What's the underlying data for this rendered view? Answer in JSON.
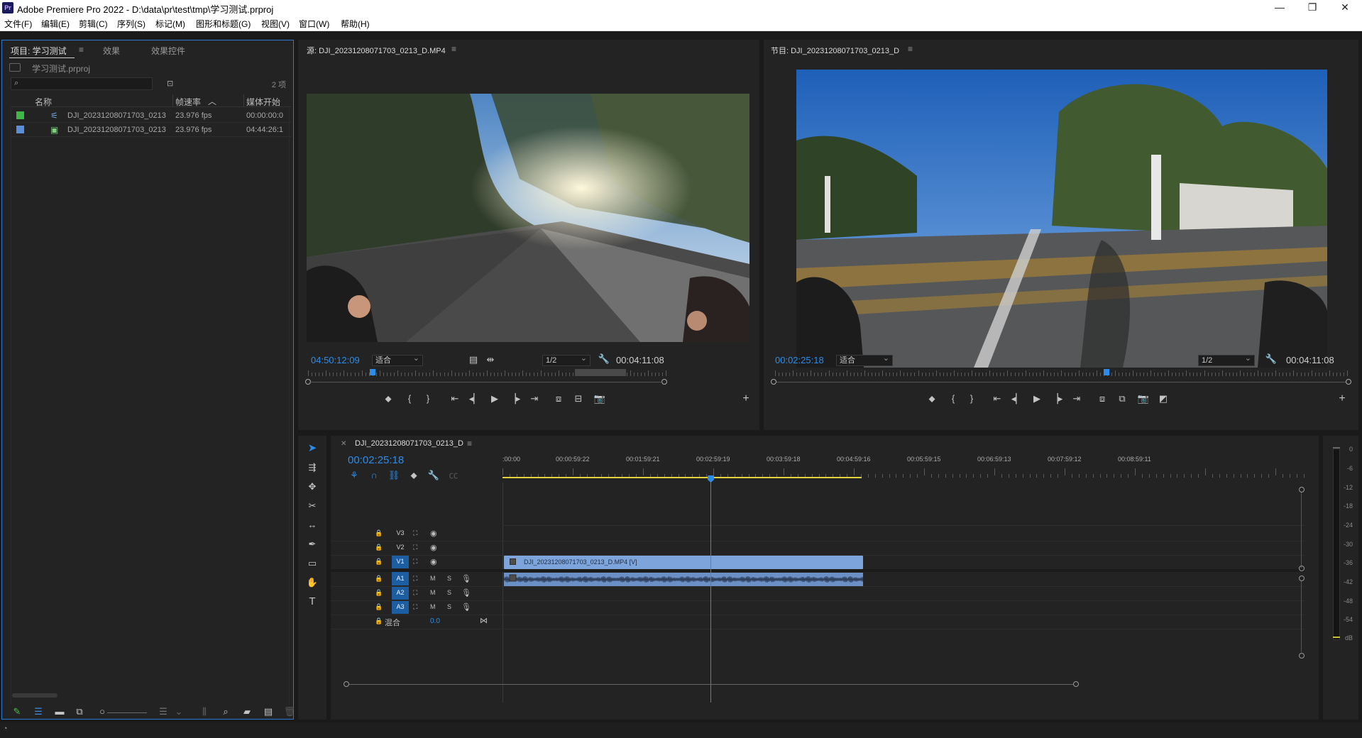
{
  "window": {
    "app_icon": "Pr",
    "title": "Adobe Premiere Pro 2022 - D:\\data\\pr\\test\\tmp\\学习测试.prproj",
    "minimize": "—",
    "maximize": "❐",
    "close": "✕"
  },
  "menu": [
    "文件(F)",
    "编辑(E)",
    "剪辑(C)",
    "序列(S)",
    "标记(M)",
    "图形和标题(G)",
    "视图(V)",
    "窗口(W)",
    "帮助(H)"
  ],
  "project": {
    "tabs": [
      "项目: 学习测试",
      "效果",
      "效果控件"
    ],
    "file_name": "学习测试.prproj",
    "search_placeholder": "",
    "item_count": "2 项",
    "columns": {
      "name": "名称",
      "fps": "帧速率",
      "start": "媒体开始"
    },
    "items": [
      {
        "label_color": "#3fb54a",
        "icon": "sequence-icon",
        "name": "DJI_20231208071703_0213",
        "fps": "23.976 fps",
        "start": "00:00:00:0"
      },
      {
        "label_color": "#5b8dd9",
        "icon": "video-clip-icon",
        "name": "DJI_20231208071703_0213",
        "fps": "23.976 fps",
        "start": "04:44:26:1"
      }
    ]
  },
  "source": {
    "title": "源: DJI_20231208071703_0213_D.MP4",
    "timecode": "04:50:12:09",
    "fit": "适合",
    "resolution": "1/2",
    "duration": "00:04:11:08",
    "playhead_fraction": 0.18
  },
  "program": {
    "title": "节目: DJI_20231208071703_0213_D",
    "timecode": "00:02:25:18",
    "fit": "适合",
    "resolution": "1/2",
    "duration": "00:04:11:08",
    "playhead_fraction": 0.58
  },
  "timeline": {
    "sequence_name": "DJI_20231208071703_0213_D",
    "timecode": "00:02:25:18",
    "ruler": [
      ":00:00",
      "00:00:59:22",
      "00:01:59:21",
      "00:02:59:19",
      "00:03:59:18",
      "00:04:59:16",
      "00:05:59:15",
      "00:06:59:13",
      "00:07:59:12",
      "00:08:59:11"
    ],
    "video_tracks": [
      "V3",
      "V2",
      "V1"
    ],
    "audio_tracks": [
      "A1",
      "A2",
      "A3"
    ],
    "mix_label": "混合",
    "mix_value": "0.0",
    "video_clip_label": "DJI_20231208071703_0213_D.MP4 [V]",
    "track_m": "M",
    "track_s": "S"
  },
  "meter": {
    "labels": [
      "0",
      "-6",
      "-12",
      "-18",
      "-24",
      "-30",
      "-36",
      "-42",
      "-48",
      "-54",
      "dB"
    ]
  },
  "colors": {
    "accent": "#2d8ceb",
    "clip_video": "#7ea5db",
    "clip_audio": "#6b90c6",
    "work_area": "#e4d23c"
  }
}
